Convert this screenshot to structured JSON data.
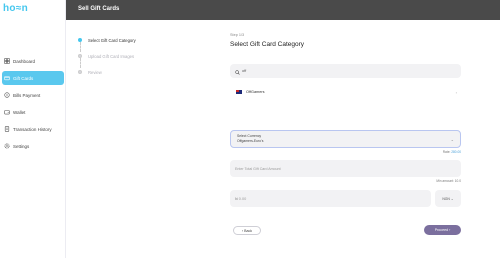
{
  "app": {
    "logo": "ho≈n"
  },
  "header": {
    "title": "Sell Gift Cards"
  },
  "sidebar": {
    "items": [
      {
        "label": "Dashboard",
        "icon": "dashboard-icon",
        "active": false
      },
      {
        "label": "Gift Cards",
        "icon": "gift-card-icon",
        "active": true
      },
      {
        "label": "Bills Payment",
        "icon": "bills-icon",
        "active": false
      },
      {
        "label": "Wallet",
        "icon": "wallet-icon",
        "active": false
      },
      {
        "label": "Transaction History",
        "icon": "history-icon",
        "active": false
      },
      {
        "label": "Settings",
        "icon": "gear-icon",
        "active": false
      }
    ]
  },
  "stepper": {
    "steps": [
      {
        "label": "Select Gift Card Category",
        "active": true
      },
      {
        "label": "Upload Gift Card Images",
        "active": false
      },
      {
        "label": "Review",
        "active": false
      }
    ]
  },
  "main": {
    "step_label": "Step 1/3",
    "title": "Select Gift Card Category"
  },
  "search": {
    "value": "off"
  },
  "result": {
    "label": "OffGamers"
  },
  "currency": {
    "label": "Select Currency",
    "value": "Offgamers-Euro's"
  },
  "rate": {
    "prefix": "Rate:",
    "value": "280.00"
  },
  "amount": {
    "placeholder": "Enter Total Gift Card Amount"
  },
  "min_amount": {
    "prefix": "Min amount:",
    "value": "10.0"
  },
  "naira": {
    "placeholder": "₦ 0.00",
    "currency": "NGN ⌄"
  },
  "buttons": {
    "back": "‹ Back",
    "proceed": "Proceed ›"
  },
  "colors": {
    "accent": "#5ac8ee",
    "header": "#4a4a4a",
    "proceed": "#7b6f9e"
  }
}
